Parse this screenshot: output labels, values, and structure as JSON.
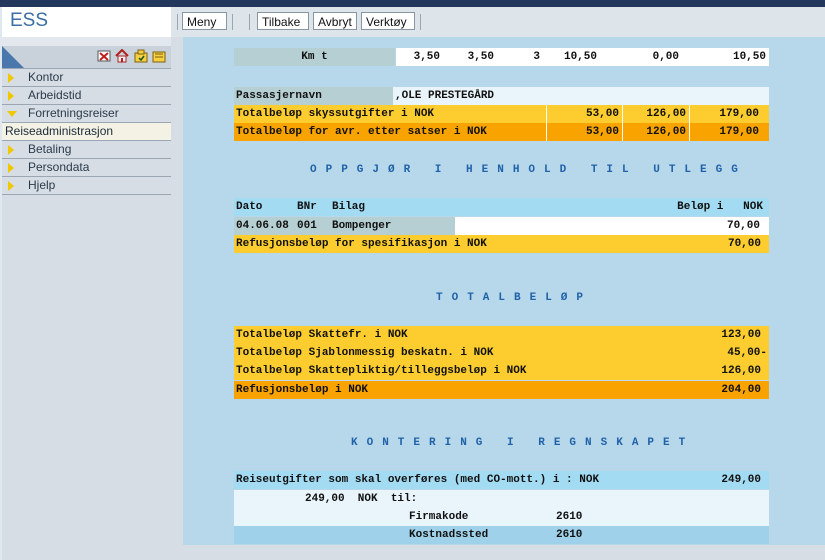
{
  "app": {
    "brand": "ESS"
  },
  "toolbar": {
    "menu_label": "Meny",
    "back_label": "Tilbake",
    "cancel_label": "Avbryt",
    "tools_label": "Verktøy"
  },
  "sidebar": {
    "items": [
      {
        "label": "Kontor"
      },
      {
        "label": "Arbeidstid"
      },
      {
        "label": "Forretningsreiser"
      },
      {
        "label": "Reiseadministrasjon"
      },
      {
        "label": "Betaling"
      },
      {
        "label": "Persondata"
      },
      {
        "label": "Hjelp"
      }
    ]
  },
  "km_row": {
    "label": "Km t",
    "v1": "3,50",
    "v2": "3,50",
    "v3": "3",
    "v4": "10,50",
    "v5": "0,00",
    "v6": "10,50"
  },
  "passenger": {
    "name_label": "Passasjernavn",
    "name_value": ",OLE PRESTEGÅRD",
    "row1": {
      "label": "Totalbeløp skyssutgifter i NOK",
      "a": "53,00",
      "b": "126,00",
      "c": "179,00"
    },
    "row2": {
      "label": "Totalbeløp for avr. etter satser i NOK",
      "a": "53,00",
      "b": "126,00",
      "c": "179,00"
    }
  },
  "settlement": {
    "title": "OPPGJØR I HENHOLD TIL UTLEGG",
    "header": {
      "date": "Dato",
      "bnr": "BNr",
      "bilag": "Bilag",
      "amount": "Beløp i   NOK"
    },
    "row": {
      "date": "04.06.08",
      "bnr": "001",
      "bilag": "Bompenger",
      "amount": "70,00"
    },
    "total": {
      "label": "Refusjonsbeløp for spesifikasjon i NOK",
      "amount": "70,00"
    }
  },
  "totals": {
    "title": "TOTALBELØP",
    "rows": [
      {
        "label": "Totalbeløp Skattefr. i NOK",
        "amount": "123,00"
      },
      {
        "label": "Totalbeløp Sjablonmessig beskatn. i NOK",
        "amount": "45,00-"
      },
      {
        "label": "Totalbeløp Skattepliktig/tilleggsbeløp i NOK",
        "amount": "126,00"
      },
      {
        "label": "Refusjonsbeløp i NOK",
        "amount": "204,00"
      }
    ]
  },
  "accounting": {
    "title": "KONTERING I REGNSKAPET",
    "header": {
      "label": "Reiseutgifter som skal overføres (med CO-mott.) i : NOK",
      "amount": "249,00"
    },
    "sum_line": "249,00  NOK  til:",
    "rows": [
      {
        "label": "Firmakode",
        "value": "2610"
      },
      {
        "label": "Kostnadssted",
        "value": "2610"
      }
    ]
  }
}
